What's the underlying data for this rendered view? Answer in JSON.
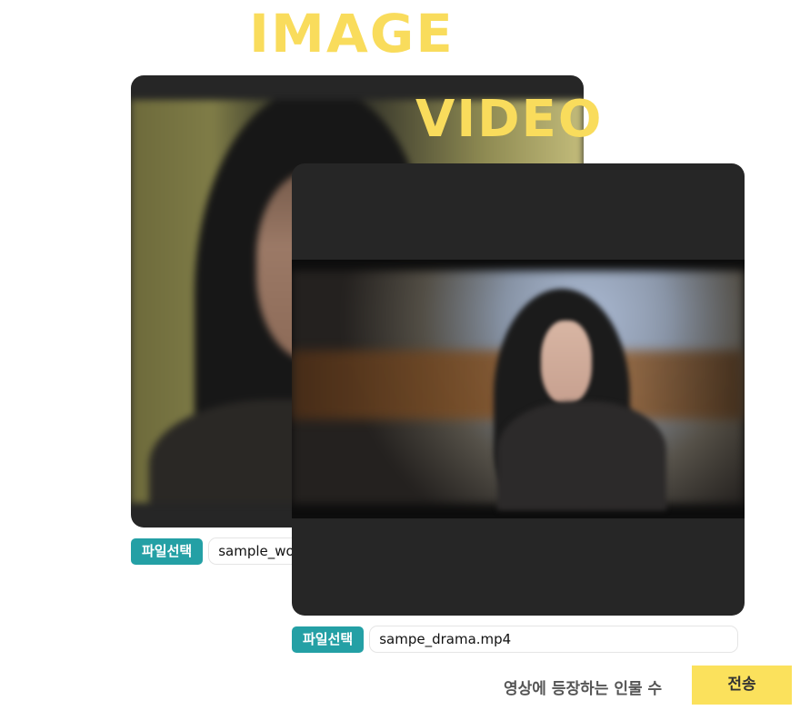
{
  "headings": {
    "image": "IMAGE",
    "video": "VIDEO"
  },
  "image_panel": {
    "file_button": "파일선택",
    "file_name": "sample_wo"
  },
  "video_panel": {
    "file_button": "파일선택",
    "file_name": "sampe_drama.mp4"
  },
  "footer": {
    "count_label": "영상에 등장하는 인물 수",
    "submit_label": "전송"
  },
  "colors": {
    "heading": "#f9dc5c",
    "card": "#262626",
    "file_button": "#24a0a5",
    "submit_button": "#fbe15c",
    "label_text": "#555555"
  },
  "icons": {}
}
